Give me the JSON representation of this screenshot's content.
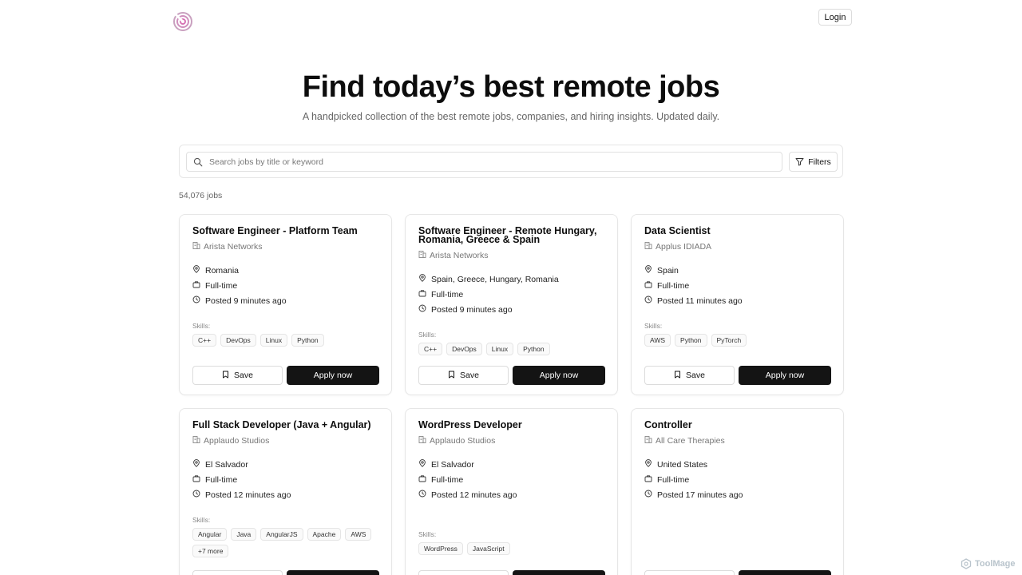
{
  "header": {
    "login_label": "Login"
  },
  "hero": {
    "title": "Find today’s best remote jobs",
    "subtitle": "A handpicked collection of the best remote jobs, companies, and hiring insights. Updated daily."
  },
  "search": {
    "placeholder": "Search jobs by title or keyword",
    "filters_label": "Filters"
  },
  "job_count": "54,076 jobs",
  "labels": {
    "skills": "Skills:",
    "save": "Save",
    "apply": "Apply now"
  },
  "jobs": [
    {
      "title": "Software Engineer - Platform Team",
      "company": "Arista Networks",
      "location": "Romania",
      "type": "Full-time",
      "posted": "Posted 9 minutes ago",
      "skills": [
        "C++",
        "DevOps",
        "Linux",
        "Python"
      ]
    },
    {
      "title": "Software Engineer - Remote Hungary, Romania, Greece & Spain",
      "company": "Arista Networks",
      "location": "Spain, Greece, Hungary, Romania",
      "type": "Full-time",
      "posted": "Posted 9 minutes ago",
      "skills": [
        "C++",
        "DevOps",
        "Linux",
        "Python"
      ]
    },
    {
      "title": "Data Scientist",
      "company": "Applus IDIADA",
      "location": "Spain",
      "type": "Full-time",
      "posted": "Posted 11 minutes ago",
      "skills": [
        "AWS",
        "Python",
        "PyTorch"
      ]
    },
    {
      "title": "Full Stack Developer (Java + Angular)",
      "company": "Applaudo Studios",
      "location": "El Salvador",
      "type": "Full-time",
      "posted": "Posted 12 minutes ago",
      "skills": [
        "Angular",
        "Java",
        "AngularJS",
        "Apache",
        "AWS",
        "+7 more"
      ]
    },
    {
      "title": "WordPress Developer",
      "company": "Applaudo Studios",
      "location": "El Salvador",
      "type": "Full-time",
      "posted": "Posted 12 minutes ago",
      "skills": [
        "WordPress",
        "JavaScript"
      ]
    },
    {
      "title": "Controller",
      "company": "All Care Therapies",
      "location": "United States",
      "type": "Full-time",
      "posted": "Posted 17 minutes ago",
      "skills": []
    }
  ],
  "watermark": "ToolMage"
}
